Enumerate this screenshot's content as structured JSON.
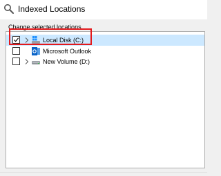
{
  "window": {
    "title": "Indexed Locations",
    "title_icon": "search-icon"
  },
  "section_label": "Change selected locations",
  "colors": {
    "selection": "#cce8ff",
    "highlight_box": "#e3191c",
    "outlook_blue": "#0a64c8"
  },
  "locations": [
    {
      "label": "Local Disk (C:)",
      "checked": true,
      "expandable": true,
      "icon": "windows-drive-icon",
      "selected": true
    },
    {
      "label": "Microsoft Outlook",
      "checked": false,
      "expandable": false,
      "icon": "outlook-icon",
      "selected": false
    },
    {
      "label": "New Volume (D:)",
      "checked": false,
      "expandable": true,
      "icon": "drive-icon",
      "selected": false
    }
  ]
}
